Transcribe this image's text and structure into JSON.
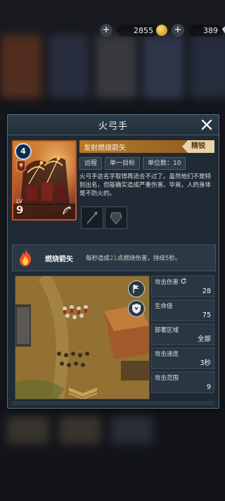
{
  "currency": {
    "coins": "2855",
    "gems": "389"
  },
  "modal": {
    "title": "火弓手",
    "close_icon": "close-icon"
  },
  "unit_card": {
    "rank_number": "4",
    "level_label": "LV",
    "level": "9",
    "class_icon": "bow-icon"
  },
  "ability": {
    "name": "发射燃烧箭矢",
    "rank": "精锐"
  },
  "tags": [
    "远程",
    "单一目标",
    "单位数：10"
  ],
  "description": "火弓手这名字取得再适合不过了。虽然他们不是特别出名，但能确实造成严重伤害。毕竟，人的身体是不防火的。",
  "skill": {
    "name": "燃烧箭矢",
    "desc_prefix": "每秒造成",
    "desc_highlight": "21",
    "desc_suffix": "点燃烧伤害，持续5秒。"
  },
  "stats": [
    {
      "label": "攻击伤害",
      "value": "28"
    },
    {
      "label": "生命值",
      "value": "75"
    },
    {
      "label": "部署区域",
      "value": "全部"
    },
    {
      "label": "攻击速度",
      "value": "3秒"
    },
    {
      "label": "攻击范围",
      "value": "9"
    }
  ],
  "colors": {
    "accent_gold": "#b57a2a",
    "rank_tag": "#e8d3a8",
    "highlight_green": "#6fd14b",
    "card_border": "#c0552a"
  }
}
